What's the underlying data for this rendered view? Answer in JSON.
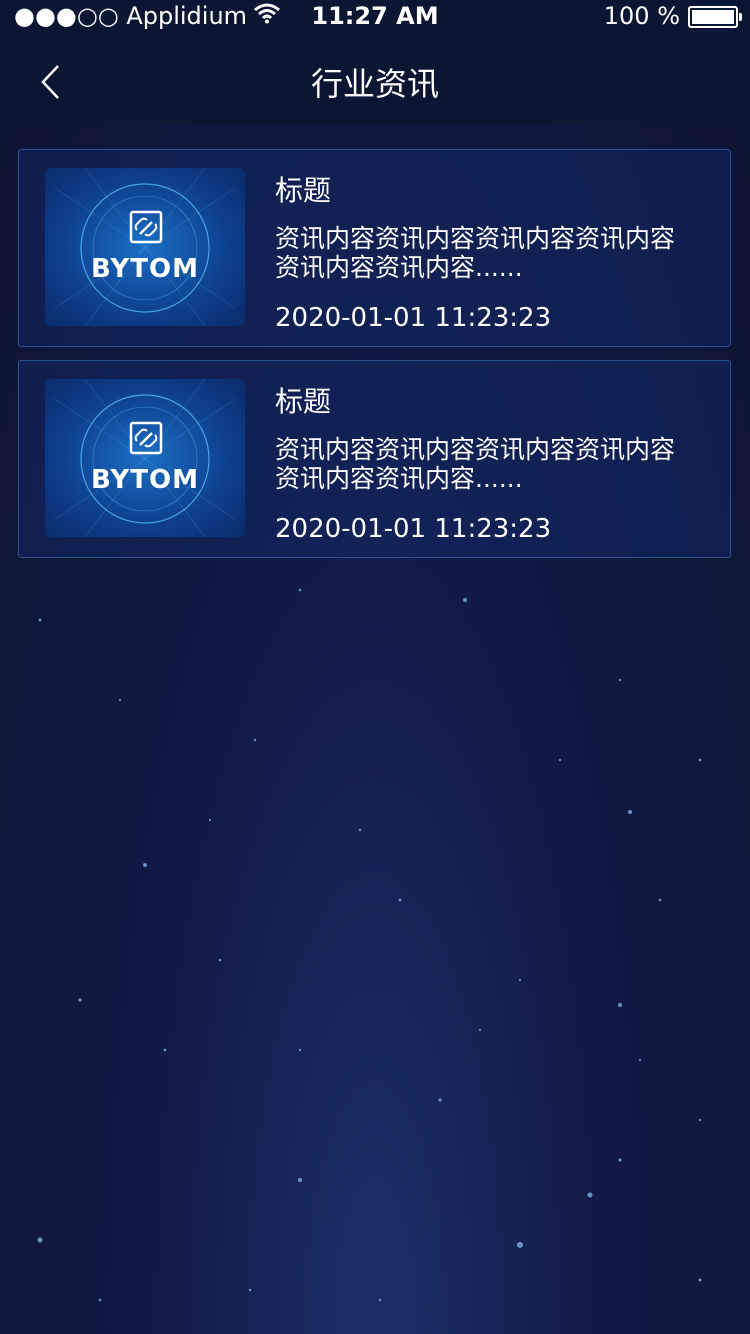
{
  "status_bar": {
    "carrier": "●●●○○ Applidium",
    "time": "11:27 AM",
    "battery": "100 %"
  },
  "nav": {
    "title": "行业资讯",
    "back_icon": "chevron-left-icon"
  },
  "news": [
    {
      "logo_text": "BYTOM",
      "title": "标题",
      "body": "资讯内容资讯内容资讯内容资讯内容资讯内容资讯内容......",
      "date": "2020-01-01 11:23:23"
    },
    {
      "logo_text": "BYTOM",
      "title": "标题",
      "body": "资讯内容资讯内容资讯内容资讯内容资讯内容资讯内容......",
      "date": "2020-01-01 11:23:23"
    }
  ],
  "colors": {
    "bar": "#0b1633",
    "card_border": "#2b4f8c",
    "background": "#111a45"
  }
}
